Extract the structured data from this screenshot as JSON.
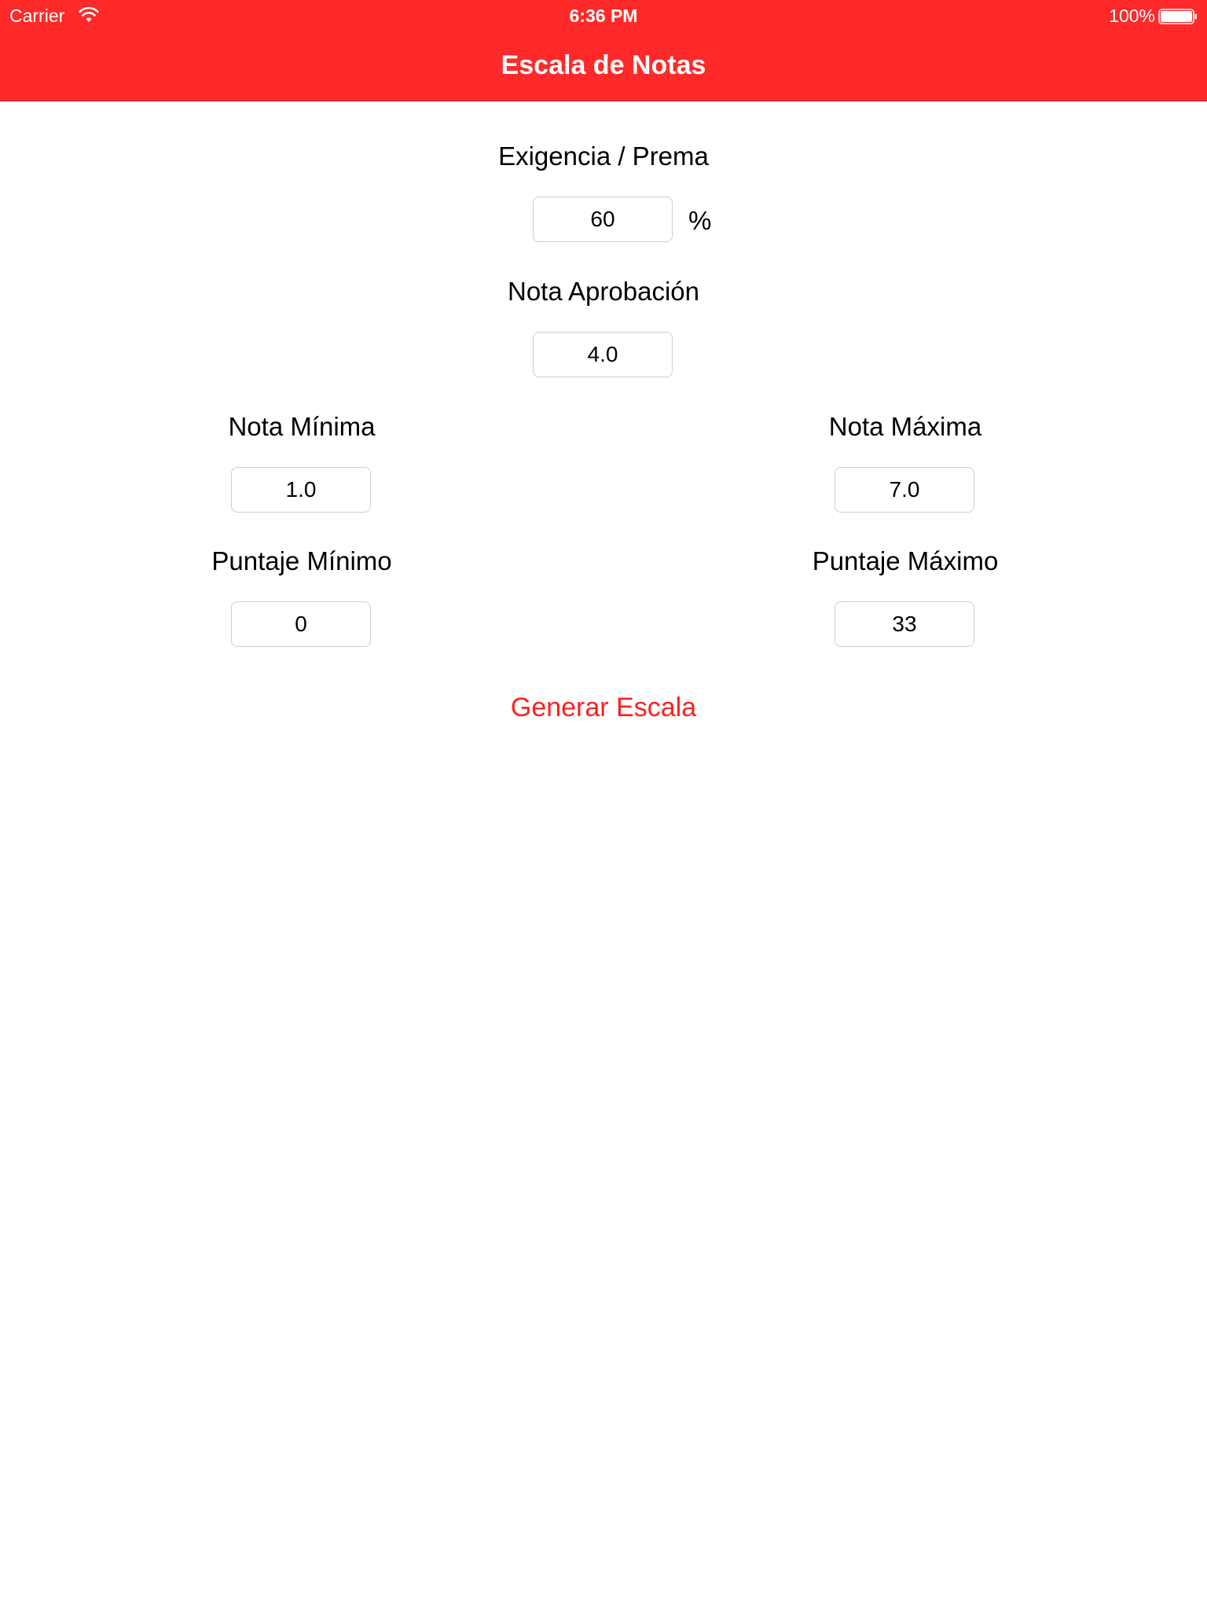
{
  "status_bar": {
    "carrier": "Carrier",
    "time": "6:36 PM",
    "battery": "100%",
    "wifi_icon": "wifi-icon",
    "battery_icon": "battery-full-icon"
  },
  "nav": {
    "title": "Escala de Notas",
    "background_color": "#ff2929"
  },
  "form": {
    "exigencia": {
      "label": "Exigencia / Prema",
      "value": "60",
      "unit": "%"
    },
    "nota_aprobacion": {
      "label": "Nota Aprobación",
      "value": "4.0"
    },
    "nota_minima": {
      "label": "Nota Mínima",
      "value": "1.0"
    },
    "nota_maxima": {
      "label": "Nota Máxima",
      "value": "7.0"
    },
    "puntaje_minimo": {
      "label": "Puntaje Mínimo",
      "value": "0"
    },
    "puntaje_maximo": {
      "label": "Puntaje Máximo",
      "value": "33"
    }
  },
  "actions": {
    "generate_label": "Generar Escala",
    "accent_color": "#ff1f1f"
  }
}
